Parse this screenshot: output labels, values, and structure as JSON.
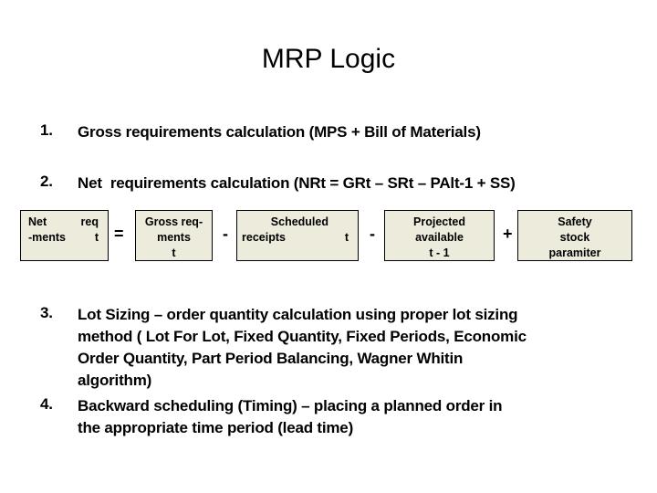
{
  "title": "MRP Logic",
  "items": [
    {
      "num": "1.",
      "text": "Gross requirements calculation (MPS + Bill of Materials)"
    },
    {
      "num": "2.",
      "text": "Net  requirements calculation (NRt = GRt – SRt – PAlt-1 + SS)"
    },
    {
      "num": "3.",
      "lines": [
        "Lot Sizing – order quantity calculation using proper lot sizing",
        "method ( Lot For Lot, Fixed Quantity, Fixed Periods, Economic",
        "Order Quantity, Part Period Balancing, Wagner Whitin",
        "algorithm)"
      ]
    },
    {
      "num": "4.",
      "lines": [
        "Backward scheduling (Timing) – placing a planned order in",
        "the appropriate time period (lead time)"
      ]
    }
  ],
  "formula": {
    "net": {
      "l1a": "Net",
      "l1b": "req",
      "l2a": "-ments",
      "l2b": "t"
    },
    "op_equals": "=",
    "gross": {
      "l1": "Gross req-",
      "l2": "ments",
      "l3": "t"
    },
    "op_minus1": "-",
    "scheduled": {
      "l1": "Scheduled",
      "l2a": "receipts",
      "l2b": "t"
    },
    "op_minus2": "-",
    "projected": {
      "l1": "Projected",
      "l2": "available",
      "l3": "t - 1"
    },
    "op_plus": "+",
    "safety": {
      "l1": "Safety",
      "l2": "stock",
      "l3": "paramiter"
    }
  }
}
